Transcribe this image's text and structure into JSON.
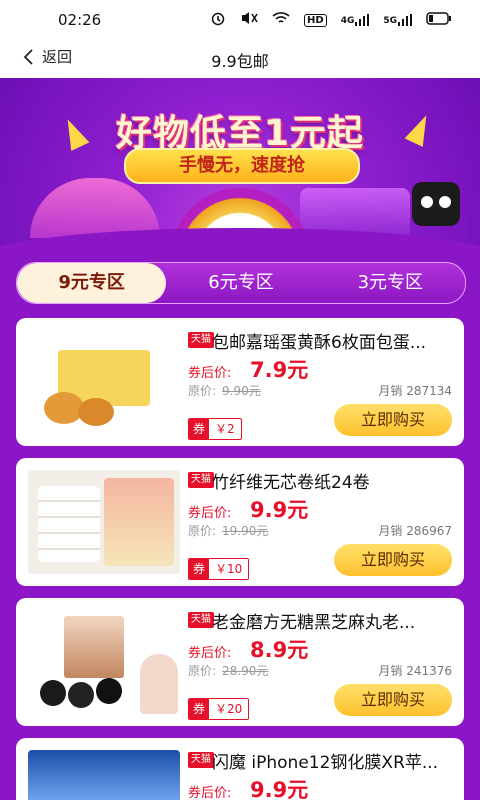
{
  "status_bar": {
    "time": "02:26",
    "icons": [
      "alarm-icon",
      "mute-icon",
      "wifi-icon",
      "hd-icon",
      "signal-4g-icon",
      "signal-5g-icon",
      "battery-icon"
    ],
    "hd": "HD",
    "net1": "4G",
    "net2": "5G"
  },
  "nav": {
    "back_label": "返回",
    "title": "9.9包邮"
  },
  "banner": {
    "headline": "好物低至1元起",
    "subline": "手慢无，速度抢"
  },
  "tabs": [
    {
      "label": "9元专区",
      "active": true
    },
    {
      "label": "6元专区",
      "active": false
    },
    {
      "label": "3元专区",
      "active": false
    }
  ],
  "products": [
    {
      "badge": "天猫",
      "title": "包邮嘉瑶蛋黄酥6枚面包蛋...",
      "after_coupon_label": "券后价:",
      "price": "7.9元",
      "original_label": "原价:",
      "original_price": "9.90元",
      "monthly_sales": "月销 287134",
      "coupon_tag": "券",
      "coupon_value": "￥2",
      "buy_label": "立即购买"
    },
    {
      "badge": "天猫",
      "title": "竹纤维无芯卷纸24卷",
      "after_coupon_label": "券后价:",
      "price": "9.9元",
      "original_label": "原价:",
      "original_price": "19.90元",
      "monthly_sales": "月销 286967",
      "coupon_tag": "券",
      "coupon_value": "￥10",
      "buy_label": "立即购买"
    },
    {
      "badge": "天猫",
      "title": "老金磨方无糖黑芝麻丸老...",
      "after_coupon_label": "券后价:",
      "price": "8.9元",
      "original_label": "原价:",
      "original_price": "28.90元",
      "monthly_sales": "月销 241376",
      "coupon_tag": "券",
      "coupon_value": "￥20",
      "buy_label": "立即购买"
    },
    {
      "badge": "天猫",
      "title": "闪魔 iPhone12钢化膜XR苹...",
      "after_coupon_label": "券后价:",
      "price": "9.9元",
      "original_label": "",
      "original_price": "",
      "monthly_sales": "",
      "coupon_tag": "",
      "coupon_value": "",
      "buy_label": ""
    }
  ],
  "colors": {
    "brand_purple": "#8b16c6",
    "price_red": "#e6102a",
    "button_yellow": "#ffc12e"
  }
}
